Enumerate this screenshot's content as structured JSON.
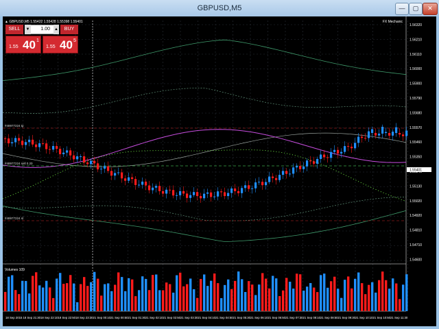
{
  "window": {
    "title": "GBPUSD,M5",
    "min_label": "—",
    "max_label": "▢",
    "close_label": "✕"
  },
  "chart": {
    "header": "▲ GBPUSD,M5  1.55422 1.55428 1.55398 1.55401",
    "expert": "FX Mechanic",
    "volumes_label": "Volumes 109",
    "up_color": "#1f8fff",
    "down_color": "#ff1b1b",
    "y_labels": [
      "1.56320",
      "1.56210",
      "1.56110",
      "1.56000",
      "1.55900",
      "1.55790",
      "1.55680",
      "1.55570",
      "1.55460",
      "1.55350",
      "1.55240",
      "1.55130",
      "1.55020",
      "1.54920",
      "1.54810",
      "1.54710",
      "1.54600"
    ],
    "price_tag": "1.55401",
    "x_labels": [
      "18 Sep 2015",
      "18 Sep 21:30",
      "18 Sep 22:10",
      "18 Sep 22:50",
      "18 Sep 23:30",
      "21 Sep 00:10",
      "21 Sep 00:50",
      "21 Sep 01:30",
      "21 Sep 02:10",
      "21 Sep 02:50",
      "21 Sep 03:30",
      "21 Sep 04:10",
      "21 Sep 04:50",
      "21 Sep 05:30",
      "21 Sep 06:10",
      "21 Sep 06:50",
      "21 Sep 07:30",
      "21 Sep 08:10",
      "21 Sep 08:50",
      "21 Sep 09:30",
      "21 Sep 10:10",
      "21 Sep 10:50",
      "21 Sep 11:30"
    ],
    "order_lines": [
      {
        "label": "#48977224 tp"
      },
      {
        "label": "#48977224 sell 0.20"
      },
      {
        "label": "#48977224 sl"
      }
    ]
  },
  "panel": {
    "sell_label": "SELL",
    "buy_label": "BUY",
    "lot": "1.00",
    "lot_down": "▼",
    "lot_up": "▲",
    "bid_prefix": "1.55",
    "bid_big": "40",
    "bid_sup": "1",
    "ask_prefix": "1.55",
    "ask_big": "40",
    "ask_sup": "5"
  }
}
